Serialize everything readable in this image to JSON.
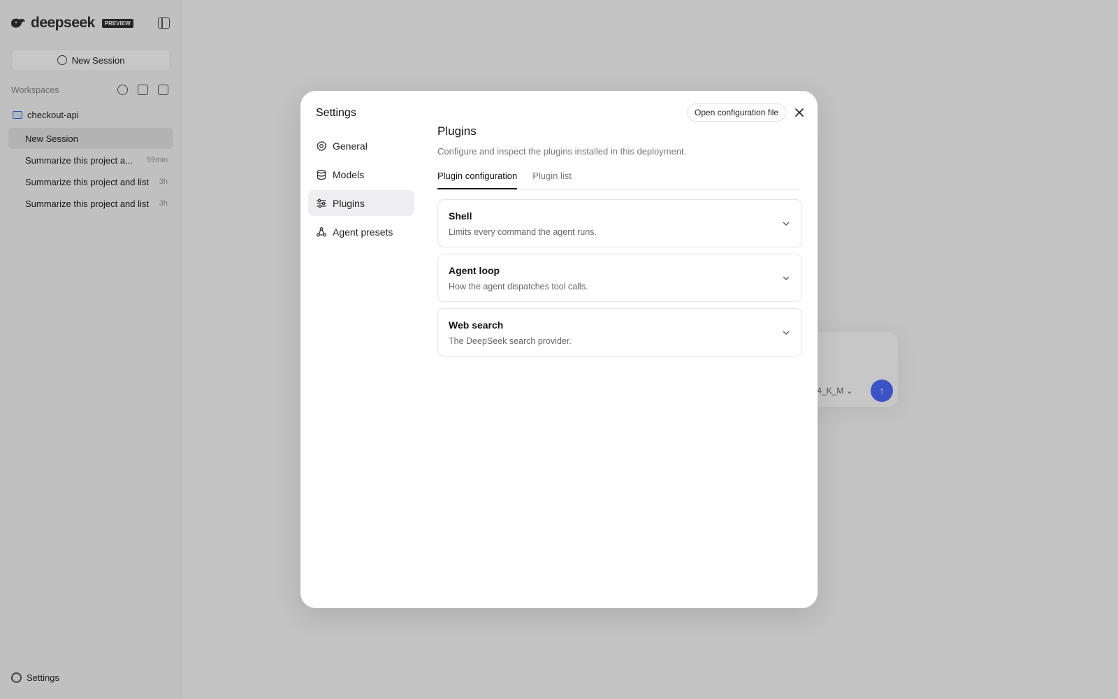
{
  "app": {
    "brand_name": "deepseek",
    "brand_badge": "PREVIEW",
    "new_session_label": "New Session",
    "workspaces_label": "Workspaces",
    "folder_name": "checkout-api",
    "sessions": [
      {
        "title": "New Session",
        "time": ""
      },
      {
        "title": "Summarize this project a...",
        "time": "59min"
      },
      {
        "title": "Summarize this project and list",
        "time": "3h"
      },
      {
        "title": "Summarize this project and list",
        "time": "3h"
      }
    ],
    "settings_label": "Settings",
    "model_label": "Q4_K_M"
  },
  "modal": {
    "title": "Settings",
    "open_config_label": "Open configuration file",
    "nav": [
      {
        "label": "General",
        "icon": "gear-icon"
      },
      {
        "label": "Models",
        "icon": "database-icon"
      },
      {
        "label": "Plugins",
        "icon": "sliders-icon",
        "active": true
      },
      {
        "label": "Agent presets",
        "icon": "presets-icon"
      }
    ],
    "section_title": "Plugins",
    "section_desc": "Configure and inspect the plugins installed in this deployment.",
    "tabs": [
      {
        "label": "Plugin configuration",
        "active": true
      },
      {
        "label": "Plugin list",
        "active": false
      }
    ],
    "plugins": [
      {
        "name": "Shell",
        "desc": "Limits every command the agent runs."
      },
      {
        "name": "Agent loop",
        "desc": "How the agent dispatches tool calls."
      },
      {
        "name": "Web search",
        "desc": "The DeepSeek search provider."
      }
    ]
  },
  "colors": {
    "accent": "#4d6bfe",
    "overlay": "rgba(0,0,0,0.22)",
    "active_nav_bg": "#eeeef0"
  }
}
